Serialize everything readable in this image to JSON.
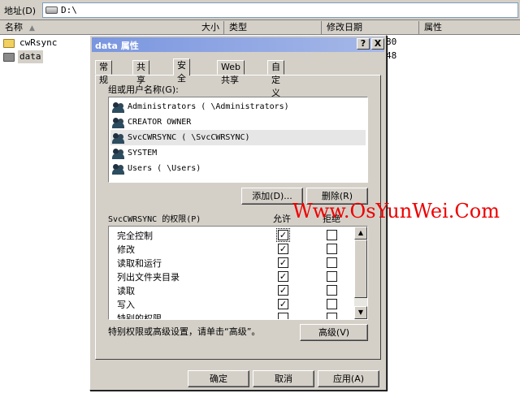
{
  "address_bar": {
    "label": "地址(D)",
    "path": "D:\\"
  },
  "columns": [
    "名称",
    "大小",
    "类型",
    "修改日期",
    "属性"
  ],
  "files": [
    {
      "name": "cwRsync",
      "fragment": "80"
    },
    {
      "name": "data",
      "fragment": "48"
    }
  ],
  "dialog": {
    "title": "data 属性",
    "help_button": "?",
    "close_button": "X",
    "tabs": [
      "常规",
      "共享",
      "安全",
      "Web 共享",
      "自定义"
    ],
    "active_tab": "安全",
    "group_label": "组或用户名称(G):",
    "users": [
      "Administrators (      \\Administrators)",
      "CREATOR OWNER",
      "SvcCWRSYNC (       \\SvcCWRSYNC)",
      "SYSTEM",
      "Users (      \\Users)"
    ],
    "selected_user_index": 2,
    "add_button": "添加(D)...",
    "remove_button": "删除(R)",
    "perm_label": "SvcCWRSYNC 的权限(P)",
    "allow_label": "允许",
    "deny_label": "拒绝",
    "permissions": [
      {
        "name": "完全控制",
        "allow": true,
        "deny": false
      },
      {
        "name": "修改",
        "allow": true,
        "deny": false
      },
      {
        "name": "读取和运行",
        "allow": true,
        "deny": false
      },
      {
        "name": "列出文件夹目录",
        "allow": true,
        "deny": false
      },
      {
        "name": "读取",
        "allow": true,
        "deny": false
      },
      {
        "name": "写入",
        "allow": true,
        "deny": false
      },
      {
        "name": "特别的权限",
        "allow": false,
        "deny": false
      }
    ],
    "advanced_hint": "特别权限或高级设置，请单击“高级”。",
    "advanced_button": "高级(V)",
    "ok_button": "确定",
    "cancel_button": "取消",
    "apply_button": "应用(A)"
  },
  "watermark": "Www.OsYunWei.Com"
}
